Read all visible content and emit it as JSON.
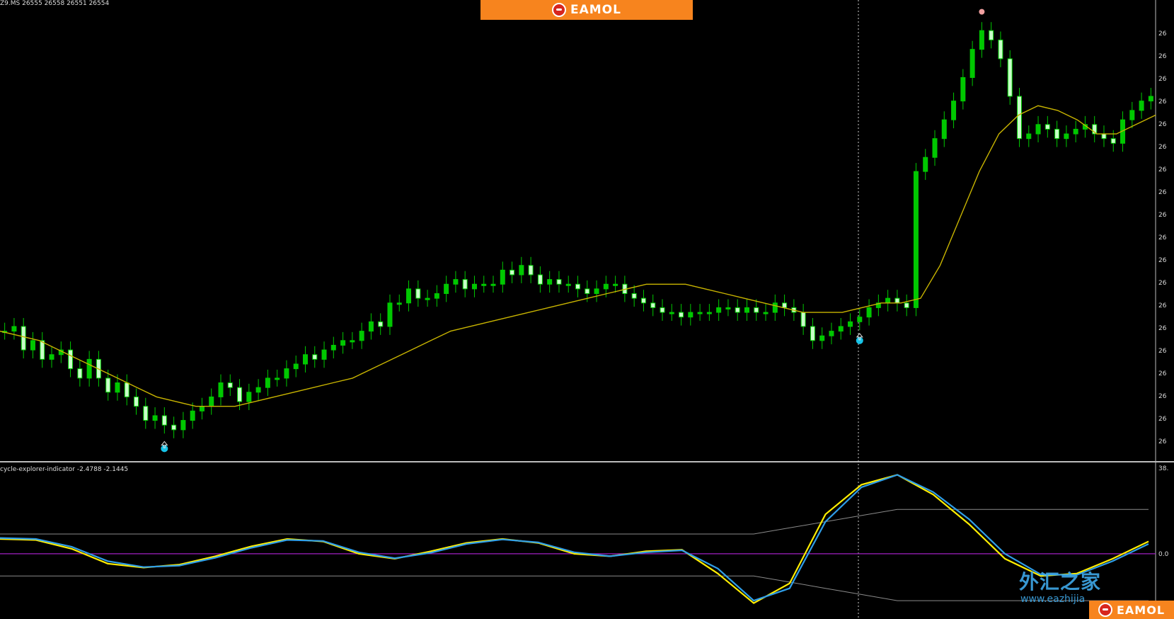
{
  "header": {
    "symbol_quote": "Z9.MS  26555 26558 26551 26554"
  },
  "indicator": {
    "label": "cycle-explorer-indicator -2.4788 -2.1445",
    "scale_top": "38.",
    "scale_zero": "0.0"
  },
  "branding": {
    "banner_text": "EAMOL",
    "corner_text": "EAMOL",
    "watermark_cn": "外汇之家",
    "watermark_url": "www.eazhijia"
  },
  "price_axis_labels": [
    "26",
    "26",
    "26",
    "26",
    "26",
    "26",
    "26",
    "26",
    "26",
    "26",
    "26",
    "26",
    "26",
    "26",
    "26",
    "26",
    "26",
    "26",
    "26"
  ],
  "colors": {
    "background": "#000000",
    "bull_candle": "#00c800",
    "bear_candle": "#c8ffc8",
    "moving_average": "#c8b400",
    "osc_fast": "#ffee00",
    "osc_slow": "#2f9ee8",
    "band": "#8a8a8a",
    "zero_line": "#a020c0",
    "signal_dot": "#17c3e8",
    "banner": "#f7841e"
  },
  "chart_data": {
    "type": "candlestick",
    "series": [
      {
        "name": "price",
        "close": [
          0.76,
          0.77,
          0.72,
          0.74,
          0.7,
          0.71,
          0.72,
          0.68,
          0.66,
          0.7,
          0.66,
          0.63,
          0.65,
          0.62,
          0.6,
          0.57,
          0.58,
          0.56,
          0.55,
          0.57,
          0.59,
          0.6,
          0.62,
          0.65,
          0.64,
          0.61,
          0.63,
          0.64,
          0.66,
          0.66,
          0.68,
          0.69,
          0.71,
          0.7,
          0.72,
          0.73,
          0.74,
          0.74,
          0.76,
          0.78,
          0.77,
          0.82,
          0.82,
          0.85,
          0.83,
          0.83,
          0.84,
          0.86,
          0.87,
          0.85,
          0.86,
          0.86,
          0.86,
          0.89,
          0.88,
          0.9,
          0.88,
          0.86,
          0.87,
          0.86,
          0.86,
          0.85,
          0.84,
          0.85,
          0.86,
          0.86,
          0.84,
          0.83,
          0.82,
          0.81,
          0.8,
          0.8,
          0.79,
          0.8,
          0.8,
          0.8,
          0.81,
          0.81,
          0.8,
          0.81,
          0.8,
          0.8,
          0.82,
          0.81,
          0.8,
          0.77,
          0.74,
          0.75,
          0.76,
          0.77,
          0.78,
          0.79,
          0.81,
          0.82,
          0.83,
          0.82,
          0.81,
          1.1,
          1.13,
          1.17,
          1.21,
          1.25,
          1.3,
          1.36,
          1.4,
          1.38,
          1.34,
          1.26,
          1.17,
          1.18,
          1.2,
          1.19,
          1.17,
          1.18,
          1.19,
          1.2,
          1.18,
          1.17,
          1.16,
          1.21,
          1.23,
          1.25,
          1.26
        ]
      },
      {
        "name": "moving_average",
        "values": [
          0.76,
          0.75,
          0.74,
          0.72,
          0.7,
          0.68,
          0.66,
          0.64,
          0.62,
          0.61,
          0.6,
          0.6,
          0.6,
          0.61,
          0.62,
          0.63,
          0.64,
          0.65,
          0.66,
          0.68,
          0.7,
          0.72,
          0.74,
          0.76,
          0.77,
          0.78,
          0.79,
          0.8,
          0.81,
          0.82,
          0.83,
          0.84,
          0.85,
          0.86,
          0.86,
          0.86,
          0.85,
          0.84,
          0.83,
          0.82,
          0.81,
          0.8,
          0.8,
          0.8,
          0.81,
          0.82,
          0.82,
          0.83,
          0.9,
          1.0,
          1.1,
          1.18,
          1.22,
          1.24,
          1.23,
          1.21,
          1.18,
          1.18,
          1.2,
          1.22
        ]
      },
      {
        "name": "osc_fast",
        "values": [
          0.3,
          0.28,
          0.1,
          -0.2,
          -0.28,
          -0.22,
          -0.05,
          0.15,
          0.3,
          0.25,
          0.0,
          -0.1,
          0.05,
          0.22,
          0.3,
          0.22,
          0.0,
          -0.05,
          0.05,
          0.08,
          -0.4,
          -1.0,
          -0.6,
          0.8,
          1.4,
          1.6,
          1.2,
          0.6,
          -0.1,
          -0.45,
          -0.4,
          -0.1,
          0.25
        ]
      },
      {
        "name": "osc_slow",
        "values": [
          0.32,
          0.3,
          0.14,
          -0.15,
          -0.27,
          -0.24,
          -0.08,
          0.12,
          0.28,
          0.26,
          0.03,
          -0.09,
          0.02,
          0.2,
          0.29,
          0.23,
          0.03,
          -0.05,
          0.03,
          0.07,
          -0.3,
          -0.95,
          -0.7,
          0.65,
          1.35,
          1.6,
          1.25,
          0.7,
          0.0,
          -0.42,
          -0.43,
          -0.15,
          0.2
        ]
      }
    ],
    "signals": [
      {
        "kind": "buy",
        "bar_index": 17
      },
      {
        "kind": "buy",
        "bar_index": 91
      },
      {
        "kind": "sell",
        "bar_index": 104
      }
    ],
    "zero_line": 0,
    "axis_top": "38."
  }
}
